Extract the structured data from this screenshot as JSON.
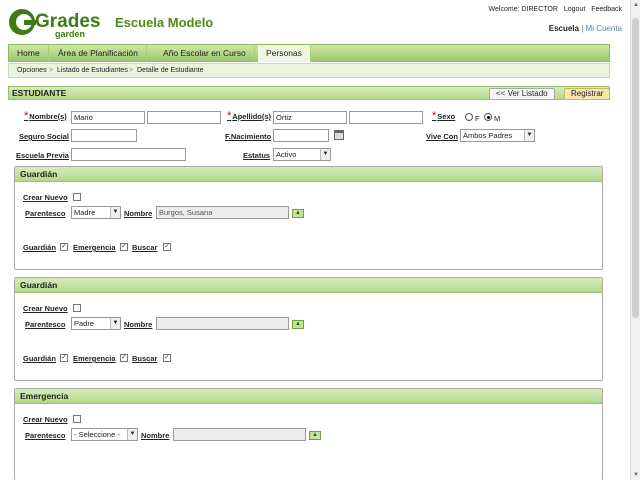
{
  "header": {
    "logo_word": "Grades",
    "logo_sub": "garden",
    "school_name": "Escuela Modelo",
    "welcome": "Welcome: DIRECTOR",
    "logout": "Logout",
    "feedback": "Feedback",
    "school_link": "Escuela",
    "separator": "|",
    "account_link": "Mi Cuenta"
  },
  "nav": {
    "tabs": [
      "Home",
      "Área de Planificación",
      "Año Escolar en Curso",
      "Personas"
    ]
  },
  "breadcrumb": {
    "items": [
      "Opciones",
      "Listado de Estudiantes",
      "Detalle de Estudiante"
    ],
    "sep": ">"
  },
  "student": {
    "title": "ESTUDIANTE",
    "btn_list": "<< Ver Listado",
    "btn_save": "Registrar",
    "nombres_label": "Nombre(s)",
    "nombres_value": "Mario",
    "apellidos_label": "Apellido(s)",
    "apellidos_value": "Ortiz",
    "sexo_label": "Sexo",
    "sex_f": "F",
    "sex_m": "M",
    "seguro_label": "Seguro Social",
    "nacimiento_label": "F.Nacimiento",
    "vive_label": "Vive Con",
    "vive_value": "Ambos Padres",
    "escuela_label": "Escuela Previa",
    "estatus_label": "Estatus",
    "estatus_value": "Activo",
    "required_mark": "*"
  },
  "guardian1": {
    "title": "Guardián",
    "crear_label": "Crear Nuevo",
    "parentesco_label": "Parentesco",
    "parentesco_value": "Madre",
    "nombre_label": "Nombre",
    "nombre_value": "Burgos, Susana",
    "guardian_label": "Guardián",
    "emergencia_label": "Emergencia",
    "buscar_label": "Buscar",
    "check_mark": "✓"
  },
  "guardian2": {
    "title": "Guardián",
    "crear_label": "Crear Nuevo",
    "parentesco_label": "Parentesco",
    "parentesco_value": "Padre",
    "nombre_label": "Nombre",
    "nombre_value": "",
    "guardian_label": "Guardián",
    "emergencia_label": "Emergencia",
    "buscar_label": "Buscar",
    "check_mark": "✓"
  },
  "emergency": {
    "title": "Emergencia",
    "crear_label": "Crear Nuevo",
    "parentesco_label": "Parentesco",
    "parentesco_value": "- Seleccione -",
    "nombre_label": "Nombre",
    "nombre_value": ""
  },
  "colors": {
    "brand_green": "#4f8a1a",
    "header_green": "#b4d88a",
    "required_red": "#d40000"
  }
}
